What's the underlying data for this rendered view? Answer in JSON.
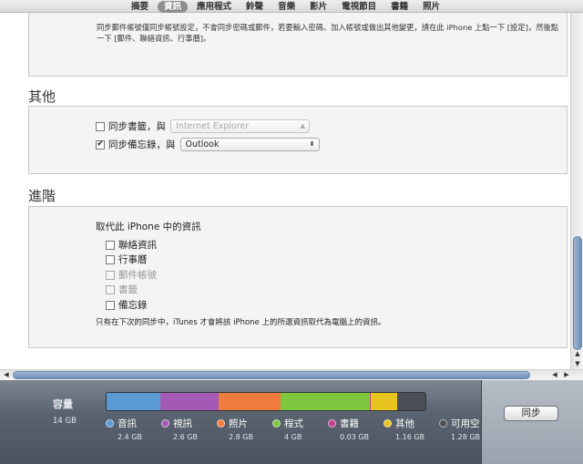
{
  "tabs": [
    "摘要",
    "資訊",
    "應用程式",
    "鈴聲",
    "音樂",
    "影片",
    "電視節目",
    "書籍",
    "照片"
  ],
  "selected_tab": "資訊",
  "mail_note": "同步郵件帳號僅同步帳號設定，不會同步密碼或郵件，若要輸入密碼、加入帳號或做出其他變更，請在此 iPhone 上點一下 [設定]，然後點一下 [郵件、聯絡資訊、行事曆]。",
  "other": {
    "title": "其他",
    "bookmarks_label": "同步書籤，與",
    "bookmarks_checked": false,
    "bookmarks_source": "Internet Explorer",
    "notes_label": "同步備忘錄，與",
    "notes_checked": true,
    "notes_source": "Outlook"
  },
  "advanced": {
    "title": "進階",
    "replace_heading": "取代此 iPhone 中的資訊",
    "items": [
      {
        "label": "聯絡資訊",
        "checked": false,
        "enabled": true
      },
      {
        "label": "行事曆",
        "checked": false,
        "enabled": true
      },
      {
        "label": "郵件帳號",
        "checked": false,
        "enabled": false
      },
      {
        "label": "書籤",
        "checked": false,
        "enabled": false
      },
      {
        "label": "備忘錄",
        "checked": false,
        "enabled": true
      }
    ],
    "footnote": "只有在下次的同步中，iTunes 才會將該 iPhone 上的所選資訊取代為電腦上的資訊。"
  },
  "capacity": {
    "title": "容量",
    "total": "14 GB",
    "segments": [
      {
        "label": "音訊",
        "size": "2.4 GB",
        "color": "#5b9bd5",
        "gb": 2.4
      },
      {
        "label": "視訊",
        "size": "2.6 GB",
        "color": "#a25ab4",
        "gb": 2.6
      },
      {
        "label": "照片",
        "size": "2.8 GB",
        "color": "#f07b3f",
        "gb": 2.8
      },
      {
        "label": "程式",
        "size": "4 GB",
        "color": "#7dc83f",
        "gb": 4
      },
      {
        "label": "書籍",
        "size": "0.03 GB",
        "color": "#c2408f",
        "gb": 0.03
      },
      {
        "label": "其他",
        "size": "1.16 GB",
        "color": "#e8c41f",
        "gb": 1.16
      },
      {
        "label": "可用空",
        "size": "1.28 GB",
        "color": "#4a4f57",
        "gb": 1.28
      }
    ]
  },
  "sync_button": "同步"
}
